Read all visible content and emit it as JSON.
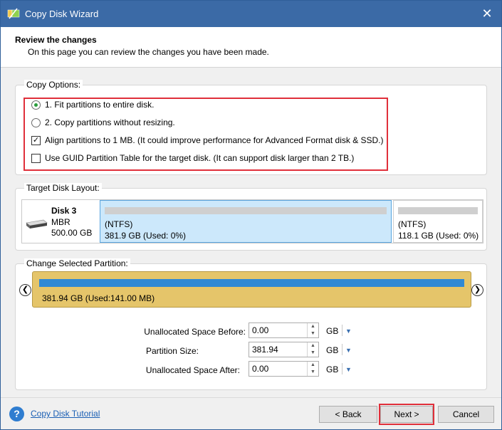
{
  "window": {
    "title": "Copy Disk Wizard",
    "close_glyph": "✕"
  },
  "header": {
    "title": "Review the changes",
    "subtitle": "On this page you can review the changes you have been made."
  },
  "copy_options": {
    "label": "Copy Options:",
    "options": [
      {
        "type": "radio",
        "label": "1. Fit partitions to entire disk.",
        "checked": true
      },
      {
        "type": "radio",
        "label": "2. Copy partitions without resizing.",
        "checked": false
      },
      {
        "type": "checkbox",
        "label": "Align partitions to 1 MB.  (It could improve performance for Advanced Format disk & SSD.)",
        "checked": true
      },
      {
        "type": "checkbox",
        "label": "Use GUID Partition Table for the target disk. (It can support disk larger than 2 TB.)",
        "checked": false
      }
    ]
  },
  "target_layout": {
    "label": "Target Disk Layout:",
    "disk": {
      "name": "Disk 3",
      "type": "MBR",
      "size": "500.00 GB",
      "icon": "hard-disk-icon"
    },
    "partitions": [
      {
        "fs": "(NTFS)",
        "info": "381.9 GB (Used: 0%)",
        "selected": true
      },
      {
        "fs": "(NTFS)",
        "info": "118.1 GB (Used: 0%)",
        "selected": false
      }
    ]
  },
  "change_partition": {
    "label": "Change Selected Partition:",
    "bar_text": "381.94 GB (Used:141.00 MB)",
    "fields": [
      {
        "label": "Unallocated Space Before:",
        "value": "0.00",
        "unit": "GB"
      },
      {
        "label": "Partition Size:",
        "value": "381.94",
        "unit": "GB"
      },
      {
        "label": "Unallocated Space After:",
        "value": "0.00",
        "unit": "GB"
      }
    ]
  },
  "footer": {
    "tutorial_link": "Copy Disk Tutorial",
    "back": "< Back",
    "next": "Next >",
    "cancel": "Cancel"
  },
  "colors": {
    "titlebar": "#3b6aa6",
    "highlight_border": "#e02f3a",
    "selected_partition": "#cce8fb",
    "partition_bar": "#e5c56a",
    "partition_fill": "#3089d4"
  }
}
